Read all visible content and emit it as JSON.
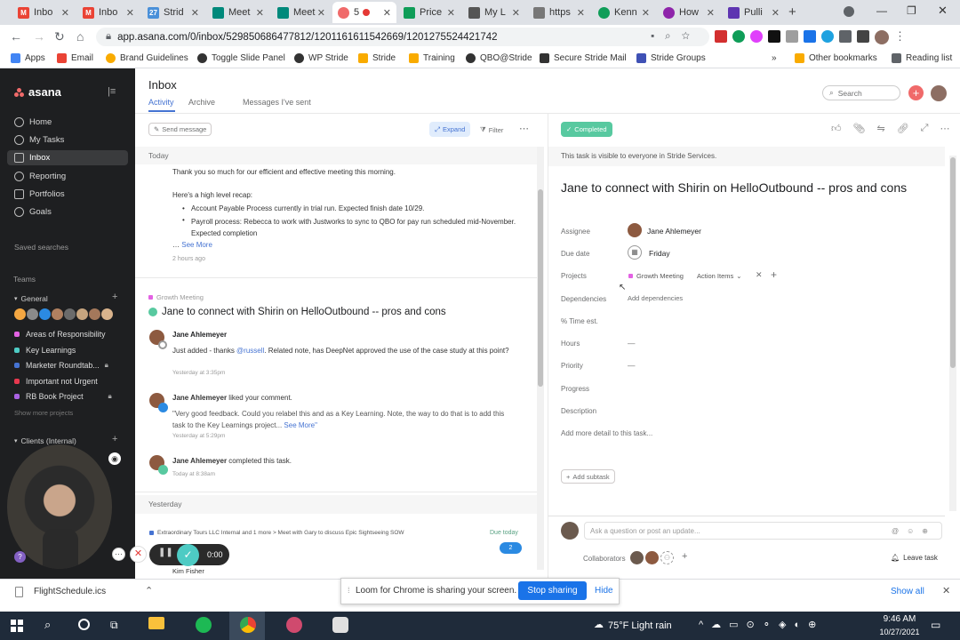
{
  "browser": {
    "tabs": [
      {
        "label": "Inbo",
        "color": "#ea4335"
      },
      {
        "label": "Inbo",
        "color": "#ea4335"
      },
      {
        "label": "Strid",
        "color": "#4a90d9"
      },
      {
        "label": "Meet",
        "color": "#00897b"
      },
      {
        "label": "Meet",
        "color": "#00897b"
      },
      {
        "label": "5",
        "color": "#f06a6a"
      },
      {
        "label": "Price",
        "color": "#0f9d58"
      },
      {
        "label": "My L",
        "color": "#555"
      },
      {
        "label": "https",
        "color": "#777"
      },
      {
        "label": "Kenn",
        "color": "#0f9d58"
      },
      {
        "label": "How",
        "color": "#8e24aa"
      },
      {
        "label": "Pulli",
        "color": "#5e35b1"
      }
    ],
    "url": "app.asana.com/0/inbox/529850686477812/1201161611542669/1201275524421742",
    "bookmarks": [
      {
        "label": "Apps",
        "color": "#4285f4"
      },
      {
        "label": "Email",
        "color": "#ea4335"
      },
      {
        "label": "Brand Guidelines",
        "color": "#f9ab00"
      },
      {
        "label": "Toggle Slide Panel",
        "color": "#333"
      },
      {
        "label": "WP Stride",
        "color": "#333"
      },
      {
        "label": "Stride",
        "color": "#f9ab00"
      },
      {
        "label": "Training",
        "color": "#f9ab00"
      },
      {
        "label": "QBO@Stride",
        "color": "#333"
      },
      {
        "label": "Secure Stride Mail",
        "color": "#333"
      },
      {
        "label": "Stride Groups",
        "color": "#3f51b5"
      }
    ],
    "more_bookmarks": "»",
    "other_bookmarks": "Other bookmarks",
    "reading_list": "Reading list"
  },
  "sidebar": {
    "logo": "asana",
    "nav": [
      "Home",
      "My Tasks",
      "Inbox",
      "Reporting",
      "Portfolios",
      "Goals"
    ],
    "saved_searches": "Saved searches",
    "teams": "Teams",
    "general": "General",
    "projects": [
      {
        "label": "Areas of Responsibility",
        "color": "#e362e3"
      },
      {
        "label": "Key Learnings",
        "color": "#4ecbc4"
      },
      {
        "label": "Marketer Roundtab...",
        "color": "#4573d2"
      },
      {
        "label": "Important not Urgent",
        "color": "#e8384f"
      },
      {
        "label": "RB Book Project",
        "color": "#aa62e3"
      }
    ],
    "show_more": "Show more projects",
    "clients_internal": "Clients (Internal)"
  },
  "inbox": {
    "title": "Inbox",
    "tabs": [
      "Activity",
      "Archive",
      "Messages I've sent"
    ],
    "send_message": "Send message",
    "expand": "Expand",
    "filter": "Filter",
    "today": "Today",
    "msg1_line1": "Thank you so much for our efficient and effective meeting this morning.",
    "msg1_line2": "Here's a high level recap:",
    "msg1_bullet1": "Account Payable Process currently in trial run. Expected finish date 10/29.",
    "msg1_bullet2": "Payroll process:  Rebecca to work with Justworks to sync to QBO for pay run scheduled mid-November.  Expected completion",
    "see_more": "See More",
    "msg1_time": "2 hours ago",
    "card_project": "Growth Meeting",
    "card_title": "Jane to connect with Shirin on HelloOutbound -- pros and cons",
    "act1_name": "Jane Ahlemeyer",
    "act1_text_a": "Just added - thanks ",
    "act1_mention": "@russell",
    "act1_text_b": ". Related note, has DeepNet approved the use of the case study  at this point?",
    "act1_time": "Yesterday at 3:35pm",
    "act2_name": "Jane Ahlemeyer",
    "act2_action": " liked your comment.",
    "act2_text": "\"Very good feedback.  Could you relabel this and as a Key Learning.  Note, the way to do that is to add this task to the Key Learnings project...",
    "act2_see_more": "See More\"",
    "act2_time": "Yesterday at 5:29pm",
    "act3_name": "Jane Ahlemeyer",
    "act3_action": " completed this task.",
    "act3_time": "Today at 8:38am",
    "yesterday": "Yesterday",
    "row_left": "Extraordinary Tours LLC Internal and 1 more  >  Meet with Gary to discuss Epic Sightseeing SOW",
    "due_today": "Due today",
    "badge_count": "2",
    "kim": "Kim Fisher",
    "recording_time": "0:00"
  },
  "task": {
    "completed": "Completed",
    "visibility": "This task is visible to everyone in Stride Services.",
    "title": "Jane to connect with Shirin on HelloOutbound -- pros and cons",
    "labels": {
      "assignee": "Assignee",
      "due": "Due date",
      "projects": "Projects",
      "dependencies": "Dependencies",
      "time": "% Time est.",
      "hours": "Hours",
      "priority": "Priority",
      "progress": "Progress",
      "description": "Description"
    },
    "assignee": "Jane Ahlemeyer",
    "due": "Friday",
    "project": "Growth Meeting",
    "section": "Action Items",
    "add_dependencies": "Add dependencies",
    "dash": "—",
    "add_detail": "Add more detail to this task...",
    "add_subtask": "Add subtask",
    "comment_placeholder": "Ask a question or post an update...",
    "collaborators": "Collaborators",
    "leave_task": "Leave task"
  },
  "search_placeholder": "Search",
  "download": {
    "file": "FlightSchedule.ics",
    "show_all": "Show all"
  },
  "loom": {
    "message": "Loom for Chrome is sharing your screen.",
    "stop": "Stop sharing",
    "hide": "Hide"
  },
  "taskbar": {
    "weather": "75°F  Light rain",
    "time": "9:46 AM",
    "date": "10/27/2021"
  },
  "colors": {
    "asana_coral": "#f06a6a",
    "completed_green": "#58c9a0",
    "link_blue": "#1a73e8"
  }
}
